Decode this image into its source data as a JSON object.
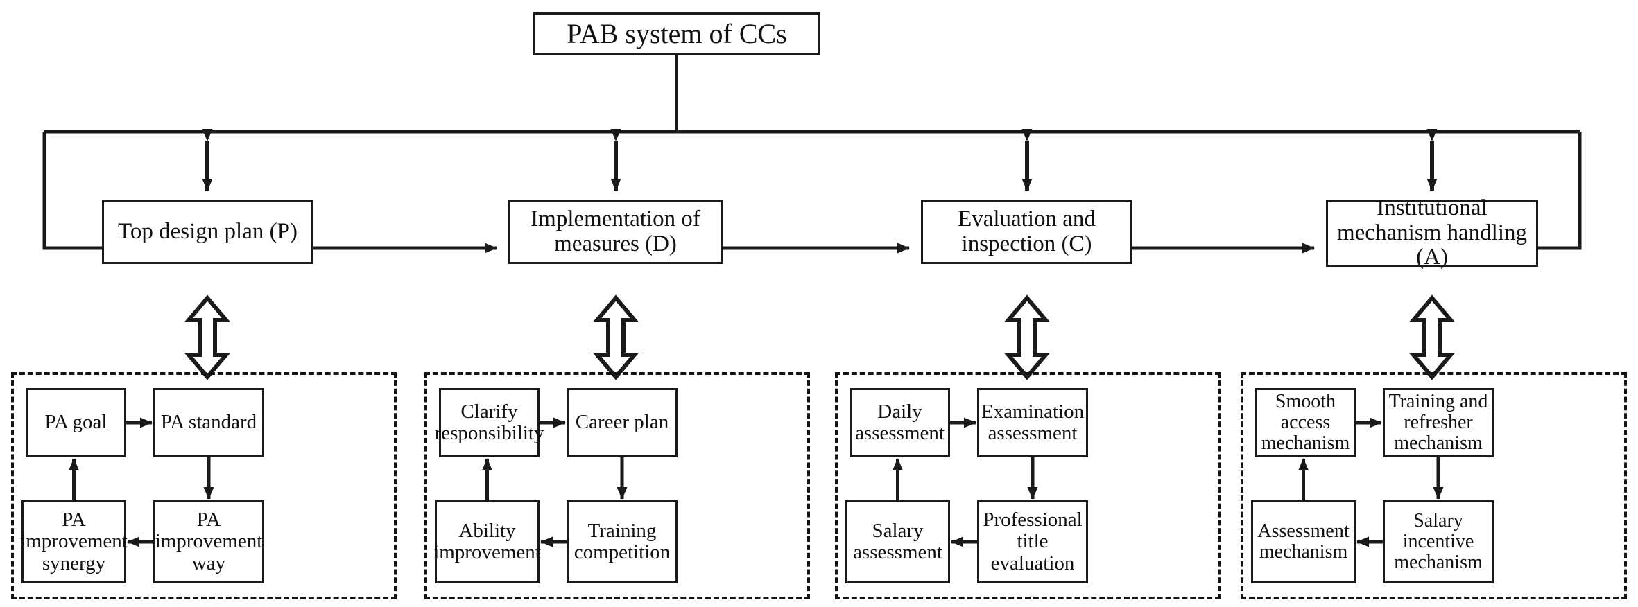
{
  "diagram": {
    "title_node": {
      "label": "PAB system of CCs"
    },
    "cycle_nodes": [
      {
        "id": "P",
        "label": "Top design plan (P)"
      },
      {
        "id": "D",
        "label": "Implementation of measures (D)"
      },
      {
        "id": "C",
        "label": "Evaluation and inspection (C)"
      },
      {
        "id": "A",
        "label": "Institutional mechanism handling (A)"
      }
    ],
    "groups": [
      {
        "id": "group-p",
        "parent": "Top design plan (P)",
        "nodes": [
          {
            "pos": "top-left",
            "label": "PA goal"
          },
          {
            "pos": "top-right",
            "label": "PA standard"
          },
          {
            "pos": "bottom-right",
            "label": "PA improvement way"
          },
          {
            "pos": "bottom-left",
            "label": "PA improvement synergy"
          }
        ]
      },
      {
        "id": "group-d",
        "parent": "Implementation of measures (D)",
        "nodes": [
          {
            "pos": "top-left",
            "label": "Clarify responsibility"
          },
          {
            "pos": "top-right",
            "label": "Career plan"
          },
          {
            "pos": "bottom-right",
            "label": "Training competition"
          },
          {
            "pos": "bottom-left",
            "label": "Ability improvement"
          }
        ]
      },
      {
        "id": "group-c",
        "parent": "Evaluation and inspection (C)",
        "nodes": [
          {
            "pos": "top-left",
            "label": "Daily assessment"
          },
          {
            "pos": "top-right",
            "label": "Examination assessment"
          },
          {
            "pos": "bottom-right",
            "label": "Professional title evaluation"
          },
          {
            "pos": "bottom-left",
            "label": "Salary assessment"
          }
        ]
      },
      {
        "id": "group-a",
        "parent": "Institutional mechanism handling (A)",
        "nodes": [
          {
            "pos": "top-left",
            "label": "Smooth access mechanism"
          },
          {
            "pos": "top-right",
            "label": "Training and refresher mechanism"
          },
          {
            "pos": "bottom-right",
            "label": "Salary incentive mechanism"
          },
          {
            "pos": "bottom-left",
            "label": "Assessment mechanism"
          }
        ]
      }
    ],
    "connectors": {
      "title_to_bus": "vertical-line",
      "bus_to_cycle": "double-headed-arrow",
      "cycle_chain": "single-arrow-right",
      "cycle_to_group": "hollow-double-headed-arrow",
      "feedback_loop": "left-and-right-wrap-line"
    },
    "colors": {
      "stroke": "#1a1a1a",
      "background": "#ffffff",
      "text": "#111111"
    }
  }
}
